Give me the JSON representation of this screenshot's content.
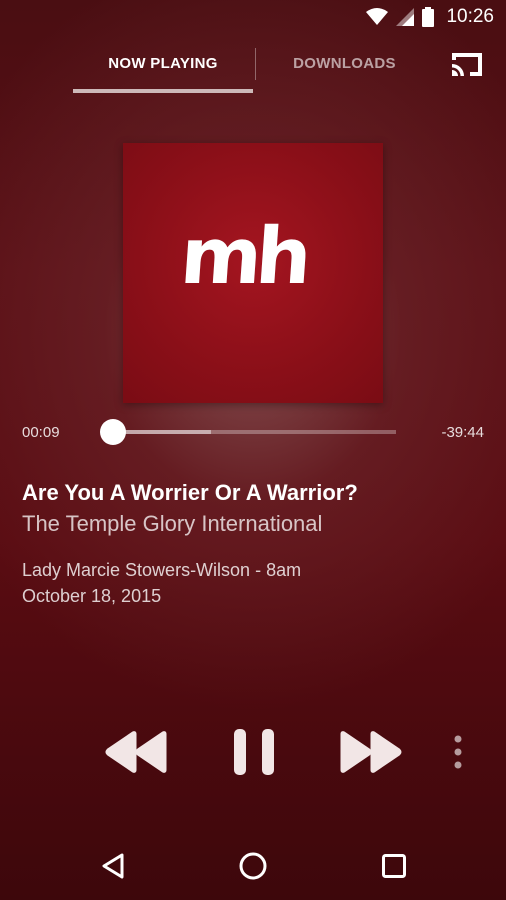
{
  "status_bar": {
    "time": "10:26",
    "icons": [
      "wifi-icon",
      "signal-icon",
      "battery-icon"
    ]
  },
  "tabs": [
    {
      "label": "NOW PLAYING",
      "active": true
    },
    {
      "label": "DOWNLOADS",
      "active": false
    }
  ],
  "toolbar": {
    "cast_icon": "cast-icon"
  },
  "artwork": {
    "logo_text": "mh",
    "background_color": "#8a0f18"
  },
  "player": {
    "elapsed": "00:09",
    "remaining": "-39:44",
    "progress": 0.004,
    "buffered": 0.35
  },
  "track": {
    "title": "Are You A Worrier Or A Warrior?",
    "subtitle": "The Temple Glory International",
    "speaker_line": "Lady Marcie Stowers-Wilson - 8am",
    "date": "October 18, 2015"
  },
  "controls": {
    "icons": [
      "rewind-icon",
      "pause-icon",
      "fast-forward-icon",
      "more-vert-icon"
    ]
  },
  "nav_bar": {
    "icons": [
      "back-icon",
      "home-icon",
      "recents-icon"
    ]
  },
  "colors": {
    "background": "#5a0f15",
    "accent": "#ffffff",
    "tab_indicator": "#cdb9b9"
  }
}
